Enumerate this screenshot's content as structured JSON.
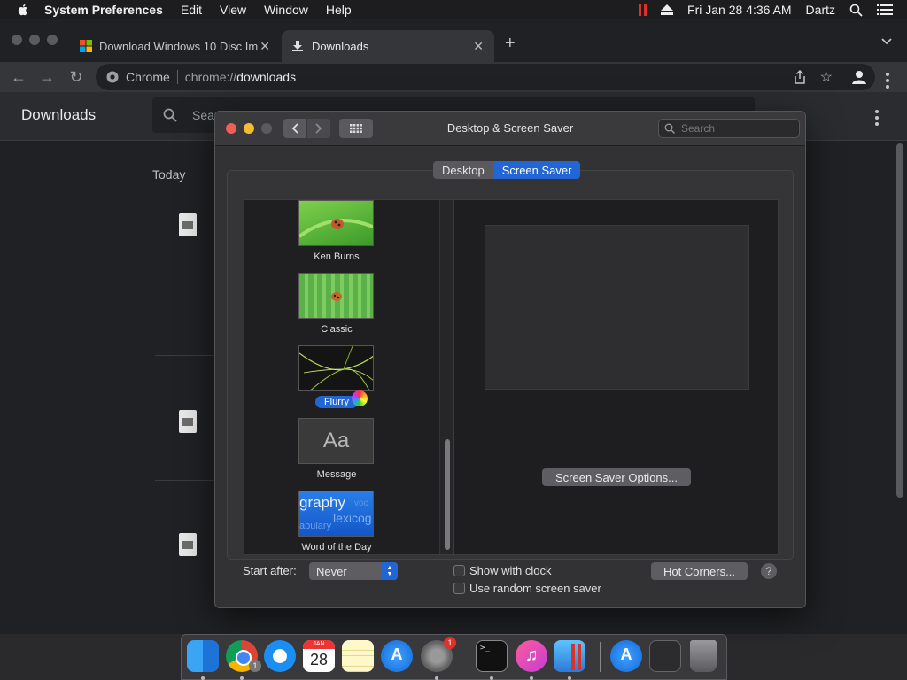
{
  "menubar": {
    "app_name": "System Preferences",
    "menus": [
      "Edit",
      "View",
      "Window",
      "Help"
    ],
    "datetime": "Fri Jan 28  4:36 AM",
    "user": "Dartz"
  },
  "chrome": {
    "tabs": [
      {
        "title": "Download Windows 10 Disc Im"
      },
      {
        "title": "Downloads"
      }
    ],
    "omnibox_label": "Chrome",
    "omnibox_url_prefix": "chrome://",
    "omnibox_url_path": "downloads",
    "page_title": "Downloads",
    "search_placeholder": "Search downloads",
    "section_today": "Today"
  },
  "prefs": {
    "window_title": "Desktop & Screen Saver",
    "search_placeholder": "Search",
    "tabs": [
      "Desktop",
      "Screen Saver"
    ],
    "selected_tab": "Screen Saver",
    "savers": [
      {
        "name": "Ken Burns"
      },
      {
        "name": "Classic"
      },
      {
        "name": "Flurry"
      },
      {
        "name": "Message"
      },
      {
        "name": "Word of the Day"
      }
    ],
    "selected_saver": "Flurry",
    "message_thumb_text": "Aa",
    "word_thumb_words": [
      "graphy",
      "lexicog",
      "abulary",
      "voc"
    ],
    "options_button": "Screen Saver Options...",
    "start_after_label": "Start after:",
    "start_after_value": "Never",
    "show_clock_label": "Show with clock",
    "random_label": "Use random screen saver",
    "hot_corners_button": "Hot Corners...",
    "help_button": "?"
  },
  "dock": {
    "calendar_month": "JAN",
    "calendar_day": "28",
    "prefs_badge": "1",
    "chrome_badge": "1"
  },
  "colors": {
    "accent": "#2166d4",
    "close": "#ee5f57",
    "minimize": "#f6be2f",
    "zoom_disabled": "#5b5b5f"
  }
}
